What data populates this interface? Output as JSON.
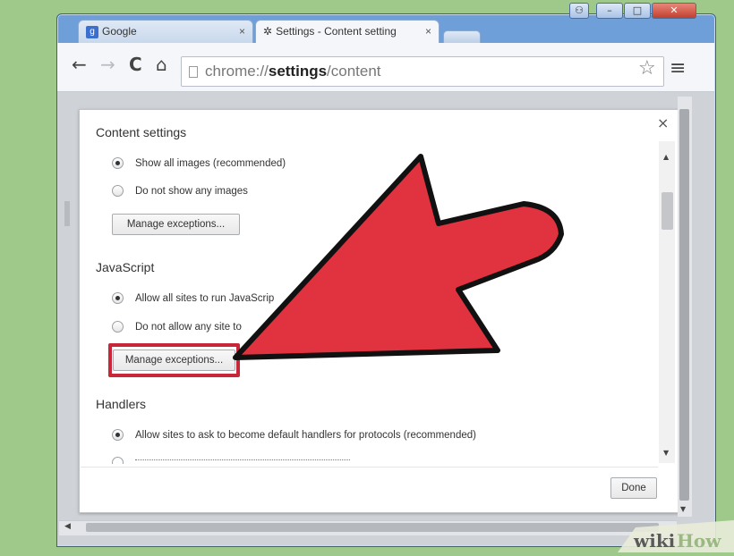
{
  "window": {
    "tabs": [
      {
        "label": "Google",
        "close": "×"
      },
      {
        "label": "Settings - Content setting",
        "close": "×"
      }
    ],
    "url_prefix": "chrome://",
    "url_bold": "settings",
    "url_suffix": "/content"
  },
  "dialog": {
    "close": "×",
    "content_title": "Content settings",
    "images_option_1": "Show all images (recommended)",
    "images_option_2": "Do not show any images",
    "manage_exceptions_1": "Manage exceptions...",
    "js_title": "JavaScript",
    "js_option_1": "Allow all sites to run JavaScrip",
    "js_option_2": "Do not allow any site to",
    "manage_exceptions_2": "Manage exceptions...",
    "handlers_title": "Handlers",
    "handlers_option_1": "Allow sites to ask to become default handlers for protocols (recommended)",
    "done": "Done"
  },
  "watermark": "wikiHow",
  "colors": {
    "arrow": "#e0323f",
    "highlight": "#c8273a"
  }
}
